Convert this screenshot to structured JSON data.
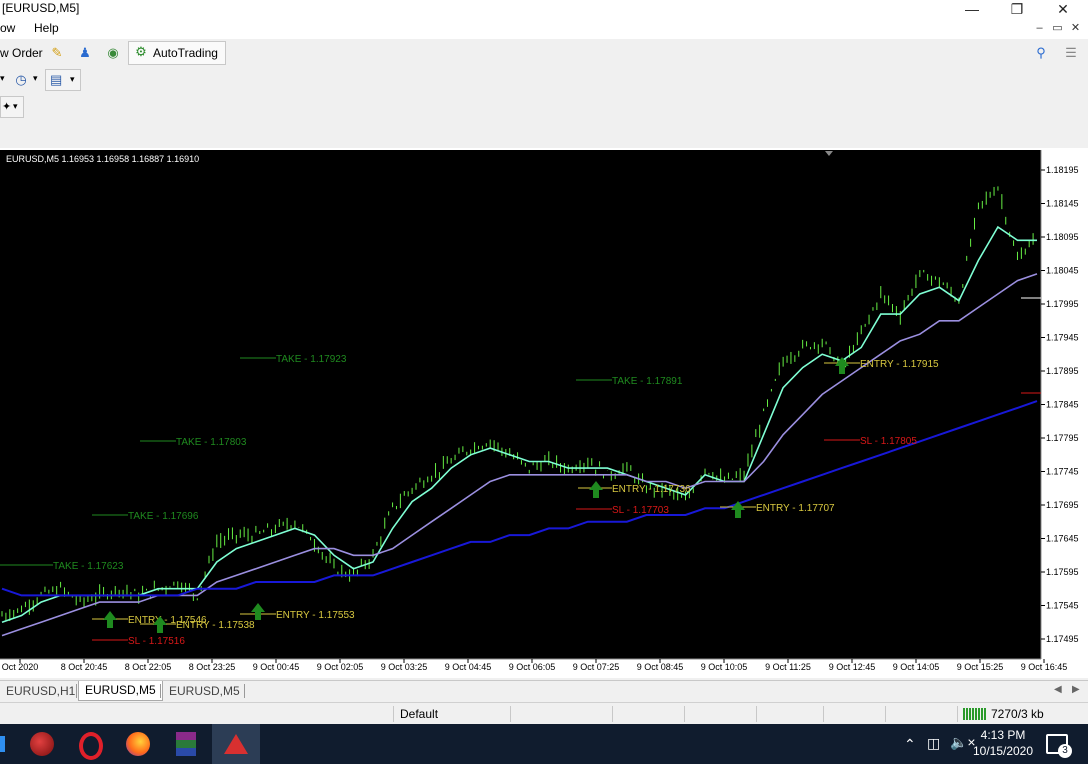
{
  "window": {
    "title": "[EURUSD,M5]"
  },
  "menu": {
    "items": [
      "ow",
      "Help"
    ]
  },
  "toolbar": {
    "new_order_label": "w Order",
    "autotrading_label": "AutoTrading"
  },
  "chart": {
    "header": "EURUSD,M5  1.16953 1.16958 1.16887 1.16910"
  },
  "chart_data": {
    "type": "line",
    "title": "EURUSD,M5  1.16953 1.16958 1.16887 1.16910",
    "ylim": [
      1.17495,
      1.18195
    ],
    "y_ticks": [
      "1.18195",
      "1.18145",
      "1.18095",
      "1.18045",
      "1.17995",
      "1.17945",
      "1.17895",
      "1.17845",
      "1.17795",
      "1.17745",
      "1.17695",
      "1.17645",
      "1.17595",
      "1.17545",
      "1.17495"
    ],
    "x_ticks": [
      "Oct 2020",
      "8 Oct 20:45",
      "8 Oct 22:05",
      "8 Oct 23:25",
      "9 Oct 00:45",
      "9 Oct 02:05",
      "9 Oct 03:25",
      "9 Oct 04:45",
      "9 Oct 06:05",
      "9 Oct 07:25",
      "9 Oct 08:45",
      "9 Oct 10:05",
      "9 Oct 11:25",
      "9 Oct 12:45",
      "9 Oct 14:05",
      "9 Oct 15:25",
      "9 Oct 16:45"
    ],
    "grid": false,
    "price": [
      1.1753,
      1.1754,
      1.1756,
      1.1757,
      1.1755,
      1.1756,
      1.1757,
      1.1756,
      1.1757,
      1.1758,
      1.1756,
      1.1764,
      1.1765,
      1.1765,
      1.1766,
      1.1767,
      1.1764,
      1.176,
      1.1759,
      1.1762,
      1.1769,
      1.1772,
      1.1774,
      1.1776,
      1.1778,
      1.1779,
      1.1777,
      1.1775,
      1.1776,
      1.1775,
      1.1776,
      1.1774,
      1.1775,
      1.1772,
      1.1772,
      1.177,
      1.1775,
      1.1773,
      1.1774,
      1.1783,
      1.1791,
      1.1793,
      1.1794,
      1.179,
      1.1795,
      1.1801,
      1.1798,
      1.1804,
      1.1803,
      1.18,
      1.1814,
      1.1817,
      1.1806,
      1.181
    ],
    "series": [
      {
        "color": "#7fffd4",
        "values": [
          1.1752,
          1.1753,
          1.1755,
          1.1756,
          1.1756,
          1.1756,
          1.1756,
          1.1756,
          1.1757,
          1.1757,
          1.1757,
          1.1761,
          1.1763,
          1.1764,
          1.1765,
          1.1766,
          1.1765,
          1.1762,
          1.176,
          1.1761,
          1.1766,
          1.177,
          1.1772,
          1.1775,
          1.1777,
          1.1778,
          1.1777,
          1.1776,
          1.1776,
          1.1775,
          1.1775,
          1.1775,
          1.1774,
          1.1773,
          1.1772,
          1.1771,
          1.1774,
          1.1773,
          1.1773,
          1.178,
          1.1787,
          1.179,
          1.1792,
          1.1791,
          1.1793,
          1.1798,
          1.1798,
          1.1801,
          1.1802,
          1.18,
          1.1806,
          1.1811,
          1.1809,
          1.1809
        ]
      },
      {
        "color": "#9b8fe0",
        "values": [
          1.175,
          1.1751,
          1.1752,
          1.1753,
          1.1754,
          1.1755,
          1.1755,
          1.1755,
          1.1756,
          1.1756,
          1.1756,
          1.1758,
          1.1759,
          1.176,
          1.1761,
          1.1762,
          1.1763,
          1.1763,
          1.1762,
          1.1762,
          1.1763,
          1.1765,
          1.1767,
          1.1769,
          1.1771,
          1.1773,
          1.1774,
          1.1774,
          1.1774,
          1.1774,
          1.1774,
          1.1774,
          1.1774,
          1.1773,
          1.1773,
          1.1772,
          1.1773,
          1.1773,
          1.1773,
          1.1776,
          1.178,
          1.1783,
          1.1786,
          1.1788,
          1.179,
          1.1792,
          1.1794,
          1.1795,
          1.1797,
          1.1797,
          1.1799,
          1.1801,
          1.1803,
          1.1804
        ]
      },
      {
        "color": "#1818d8",
        "values": [
          1.1757,
          1.1756,
          1.1756,
          1.1756,
          1.1756,
          1.1756,
          1.1756,
          1.1756,
          1.1756,
          1.1756,
          1.1757,
          1.1757,
          1.1757,
          1.1758,
          1.1758,
          1.1758,
          1.1758,
          1.1759,
          1.1759,
          1.1759,
          1.176,
          1.1761,
          1.1762,
          1.1763,
          1.1764,
          1.1764,
          1.1765,
          1.1765,
          1.1766,
          1.1766,
          1.1767,
          1.1767,
          1.1767,
          1.1768,
          1.1768,
          1.1768,
          1.1769,
          1.1769,
          1.177,
          1.1771,
          1.1772,
          1.1773,
          1.1774,
          1.1775,
          1.1776,
          1.1777,
          1.1778,
          1.1779,
          1.178,
          1.1781,
          1.1782,
          1.1783,
          1.1784,
          1.1785
        ]
      }
    ],
    "annotations": [
      {
        "text": "TAKE - 1.17623",
        "color": "#1f8a1f"
      },
      {
        "text": "TAKE - 1.17696",
        "color": "#1f8a1f"
      },
      {
        "text": "TAKE - 1.17803",
        "color": "#1f8a1f"
      },
      {
        "text": "TAKE - 1.17923",
        "color": "#1f8a1f"
      },
      {
        "text": "TAKE - 1.17891",
        "color": "#1f8a1f"
      },
      {
        "text": "ENTRY - 1.17546",
        "color": "#d8c840"
      },
      {
        "text": "ENTRY - 1.17538",
        "color": "#d8c840"
      },
      {
        "text": "ENTRY - 1.17553",
        "color": "#d8c840"
      },
      {
        "text": "ENTRY - 1.17736",
        "color": "#d8c840"
      },
      {
        "text": "ENTRY - 1.17707",
        "color": "#d8c840"
      },
      {
        "text": "ENTRY - 1.17915",
        "color": "#d8c840"
      },
      {
        "text": "SL - 1.17516",
        "color": "#d81818"
      },
      {
        "text": "SL - 1.17703",
        "color": "#d81818"
      },
      {
        "text": "SL - 1.17805",
        "color": "#d81818"
      }
    ]
  },
  "tabs": [
    "EURUSD,H1",
    "EURUSD,M5",
    "EURUSD,M5"
  ],
  "status": {
    "profile": "Default",
    "traffic": "7270/3 kb"
  },
  "taskbar": {
    "time": "4:13 PM",
    "date": "10/15/2020",
    "notifications": "3"
  }
}
